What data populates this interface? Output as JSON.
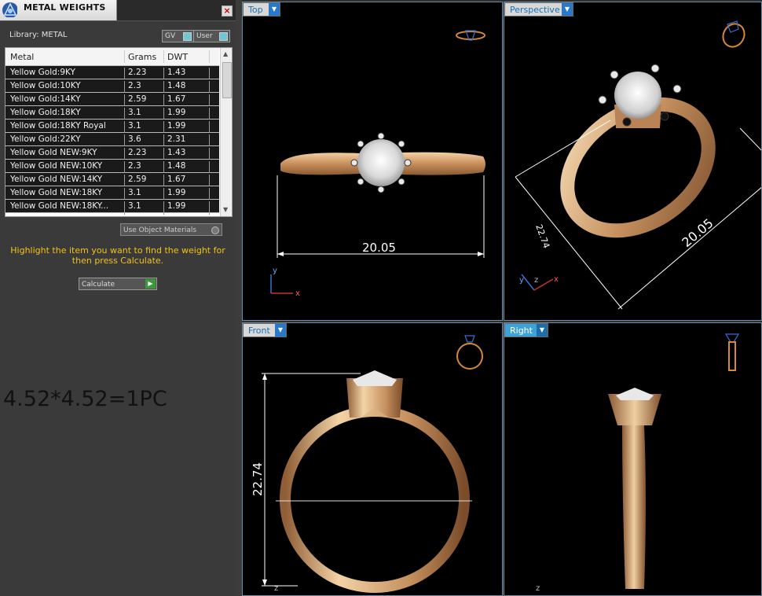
{
  "panel": {
    "title": "METAL WEIGHTS",
    "close_label": "×",
    "library_label": "Library: METAL",
    "gv_label": "GV",
    "user_label": "User",
    "columns": [
      "Metal",
      "Grams",
      "DWT"
    ],
    "rows": [
      {
        "metal": "Yellow Gold:9KY",
        "grams": "2.23",
        "dwt": "1.43"
      },
      {
        "metal": "Yellow Gold:10KY",
        "grams": "2.3",
        "dwt": "1.48"
      },
      {
        "metal": "Yellow Gold:14KY",
        "grams": "2.59",
        "dwt": "1.67"
      },
      {
        "metal": "Yellow Gold:18KY",
        "grams": "3.1",
        "dwt": "1.99"
      },
      {
        "metal": "Yellow Gold:18KY Royal",
        "grams": "3.1",
        "dwt": "1.99"
      },
      {
        "metal": "Yellow Gold:22KY",
        "grams": "3.6",
        "dwt": "2.31"
      },
      {
        "metal": "Yellow Gold NEW:9KY",
        "grams": "2.23",
        "dwt": "1.43"
      },
      {
        "metal": "Yellow Gold NEW:10KY",
        "grams": "2.3",
        "dwt": "1.48"
      },
      {
        "metal": "Yellow Gold NEW:14KY",
        "grams": "2.59",
        "dwt": "1.67"
      },
      {
        "metal": "Yellow Gold NEW:18KY",
        "grams": "3.1",
        "dwt": "1.99"
      },
      {
        "metal": "Yellow Gold NEW:18KY...",
        "grams": "3.1",
        "dwt": "1.99"
      }
    ],
    "use_object_materials_label": "Use Object Materials",
    "instruction": "Highlight the item you want to find the weight for then press Calculate.",
    "calculate_label": "Calculate"
  },
  "note": "4.52*4.52=1PC",
  "viewports": {
    "top": {
      "label": "Top",
      "dimension": "20.05",
      "axis_y": "y",
      "axis_x": "x"
    },
    "perspective": {
      "label": "Perspective",
      "dimension_long": "20.05",
      "dimension_short": "22.74",
      "axis_y": "y",
      "axis_z": "z",
      "axis_x": "x"
    },
    "front": {
      "label": "Front",
      "dimension": "22.74",
      "axis_z": "z"
    },
    "right": {
      "label": "Right",
      "axis_z": "z"
    }
  },
  "colors": {
    "gold": "#d8a878",
    "label_active": "#3da2d6",
    "instruction_text": "#f2c21a"
  }
}
